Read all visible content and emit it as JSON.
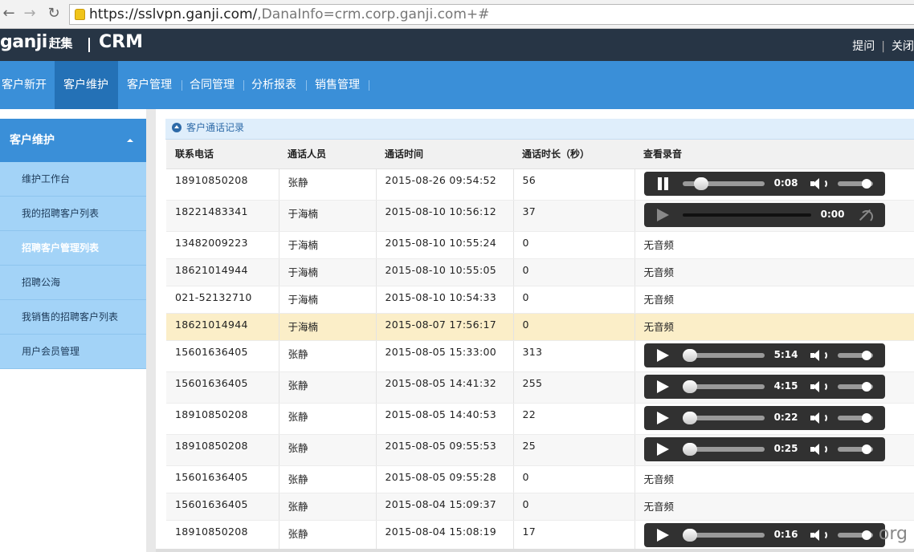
{
  "browser": {
    "url_host": "https://sslvpn.ganji.com/",
    "url_path": ",DanaInfo=crm.corp.ganji.com+#"
  },
  "header": {
    "logo_text": "ganji",
    "logo_cn": "赶集",
    "app_name": "CRM",
    "links": [
      "提问",
      "关闭"
    ]
  },
  "top_nav": {
    "items": [
      "客户新开",
      "客户维护",
      "客户管理",
      "合同管理",
      "分析报表",
      "销售管理"
    ],
    "active_index": 1
  },
  "sidebar": {
    "title": "客户维护",
    "items": [
      "维护工作台",
      "我的招聘客户列表",
      "招聘客户管理列表",
      "招聘公海",
      "我销售的招聘客户列表",
      "用户会员管理"
    ],
    "active_index": 2
  },
  "panel": {
    "title": "客户通话记录",
    "columns": [
      "联系电话",
      "通话人员",
      "通话时间",
      "通话时长（秒）",
      "查看录音"
    ],
    "no_audio_text": "无音频",
    "rows": [
      {
        "phone": "18910850208",
        "person": "张静",
        "time": "2015-08-26 09:54:52",
        "duration": "56",
        "audio": {
          "state": "pause",
          "label": "0:08",
          "progress": 0.14
        }
      },
      {
        "phone": "18221483341",
        "person": "于海楠",
        "time": "2015-08-10 10:56:12",
        "duration": "37",
        "audio": {
          "state": "disabled",
          "label": "0:00",
          "progress": 0
        }
      },
      {
        "phone": "13482009223",
        "person": "于海楠",
        "time": "2015-08-10 10:55:24",
        "duration": "0",
        "audio": null
      },
      {
        "phone": "18621014944",
        "person": "于海楠",
        "time": "2015-08-10 10:55:05",
        "duration": "0",
        "audio": null
      },
      {
        "phone": "021-52132710",
        "person": "于海楠",
        "time": "2015-08-10 10:54:33",
        "duration": "0",
        "audio": null
      },
      {
        "phone": "18621014944",
        "person": "于海楠",
        "time": "2015-08-07 17:56:17",
        "duration": "0",
        "audio": null,
        "highlight": true
      },
      {
        "phone": "15601636405",
        "person": "张静",
        "time": "2015-08-05 15:33:00",
        "duration": "313",
        "audio": {
          "state": "play",
          "label": "5:14",
          "progress": 0
        }
      },
      {
        "phone": "15601636405",
        "person": "张静",
        "time": "2015-08-05 14:41:32",
        "duration": "255",
        "audio": {
          "state": "play",
          "label": "4:15",
          "progress": 0
        }
      },
      {
        "phone": "18910850208",
        "person": "张静",
        "time": "2015-08-05 14:40:53",
        "duration": "22",
        "audio": {
          "state": "play",
          "label": "0:22",
          "progress": 0
        }
      },
      {
        "phone": "18910850208",
        "person": "张静",
        "time": "2015-08-05 09:55:53",
        "duration": "25",
        "audio": {
          "state": "play",
          "label": "0:25",
          "progress": 0
        }
      },
      {
        "phone": "15601636405",
        "person": "张静",
        "time": "2015-08-05 09:55:28",
        "duration": "0",
        "audio": null
      },
      {
        "phone": "15601636405",
        "person": "张静",
        "time": "2015-08-04 15:09:37",
        "duration": "0",
        "audio": null
      },
      {
        "phone": "18910850208",
        "person": "张静",
        "time": "2015-08-04 15:08:19",
        "duration": "17",
        "audio": {
          "state": "play",
          "label": "0:16",
          "progress": 0
        }
      }
    ]
  },
  "watermark": "org",
  "colors": {
    "header_bg": "#273545",
    "nav_bg": "#3a8fd8",
    "nav_active": "#2471b6",
    "sidebar_item_bg": "#a3d3f7",
    "highlight_row": "#fbeec8",
    "player_bg": "#313131"
  }
}
